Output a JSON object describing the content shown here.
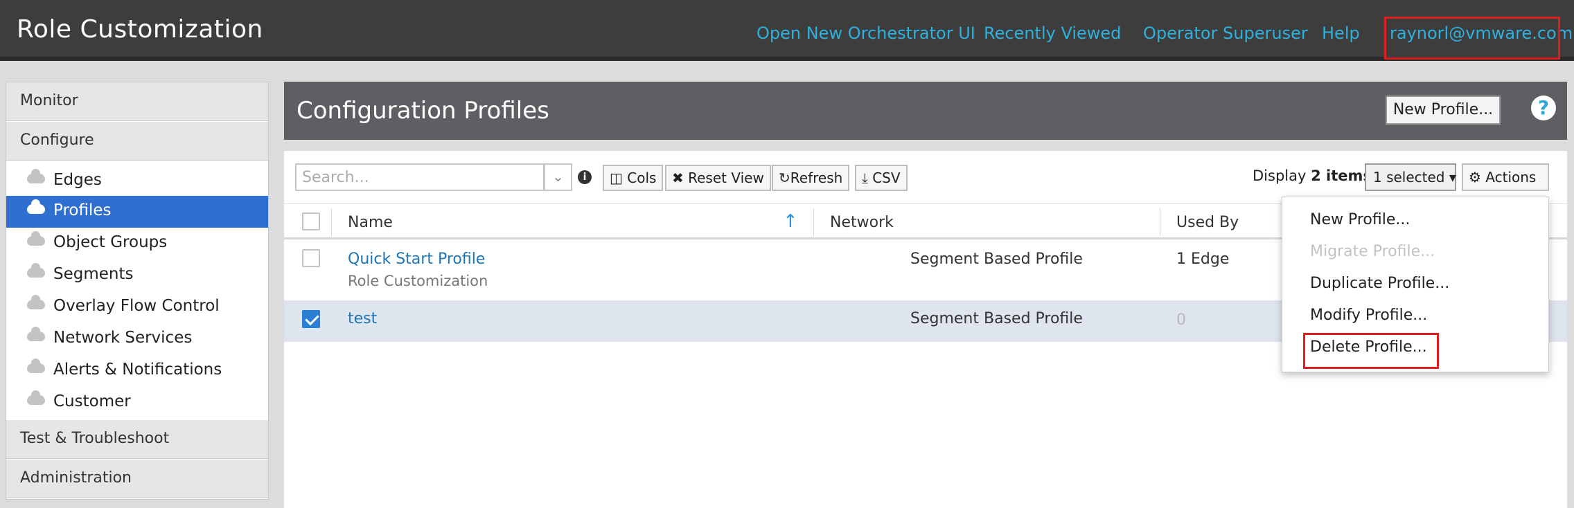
{
  "app": {
    "title": "Role Customization"
  },
  "topnav": {
    "items": [
      "Open New Orchestrator UI",
      "Recently Viewed",
      "Operator Superuser",
      "Help"
    ],
    "user": "raynorl@vmware.com"
  },
  "sidebar": {
    "sections": [
      "Monitor",
      "Configure",
      "Test & Troubleshoot",
      "Administration"
    ],
    "configure_items": [
      "Edges",
      "Profiles",
      "Object Groups",
      "Segments",
      "Overlay Flow Control",
      "Network Services",
      "Alerts & Notifications",
      "Customer"
    ],
    "active": "Profiles"
  },
  "main": {
    "title": "Configuration Profiles",
    "new_profile_label": "New Profile...",
    "help_glyph": "?"
  },
  "toolbar": {
    "search_placeholder": "Search...",
    "cols": "Cols",
    "reset_view": "Reset View",
    "refresh": "Refresh",
    "csv": "CSV",
    "display_prefix": "Display",
    "display_count": "2 items",
    "selected_label": "1 selected",
    "actions_label": "Actions"
  },
  "table": {
    "headers": {
      "name": "Name",
      "network": "Network",
      "used_by": "Used By"
    },
    "rows": [
      {
        "name": "Quick Start Profile",
        "subtitle": "Role Customization",
        "network": "Segment Based Profile",
        "used_by": "1 Edge",
        "checked": false
      },
      {
        "name": "test",
        "subtitle": "",
        "network": "Segment Based Profile",
        "used_by": "0",
        "checked": true
      }
    ]
  },
  "actions_menu": {
    "items": [
      {
        "label": "New Profile...",
        "enabled": true
      },
      {
        "label": "Migrate Profile...",
        "enabled": false
      },
      {
        "label": "Duplicate Profile...",
        "enabled": true
      },
      {
        "label": "Modify Profile...",
        "enabled": true
      },
      {
        "label": "Delete Profile...",
        "enabled": true
      }
    ]
  },
  "colors": {
    "accent_link": "#2fb1de",
    "active_nav": "#2e6fcf",
    "highlight": "#e02020"
  }
}
